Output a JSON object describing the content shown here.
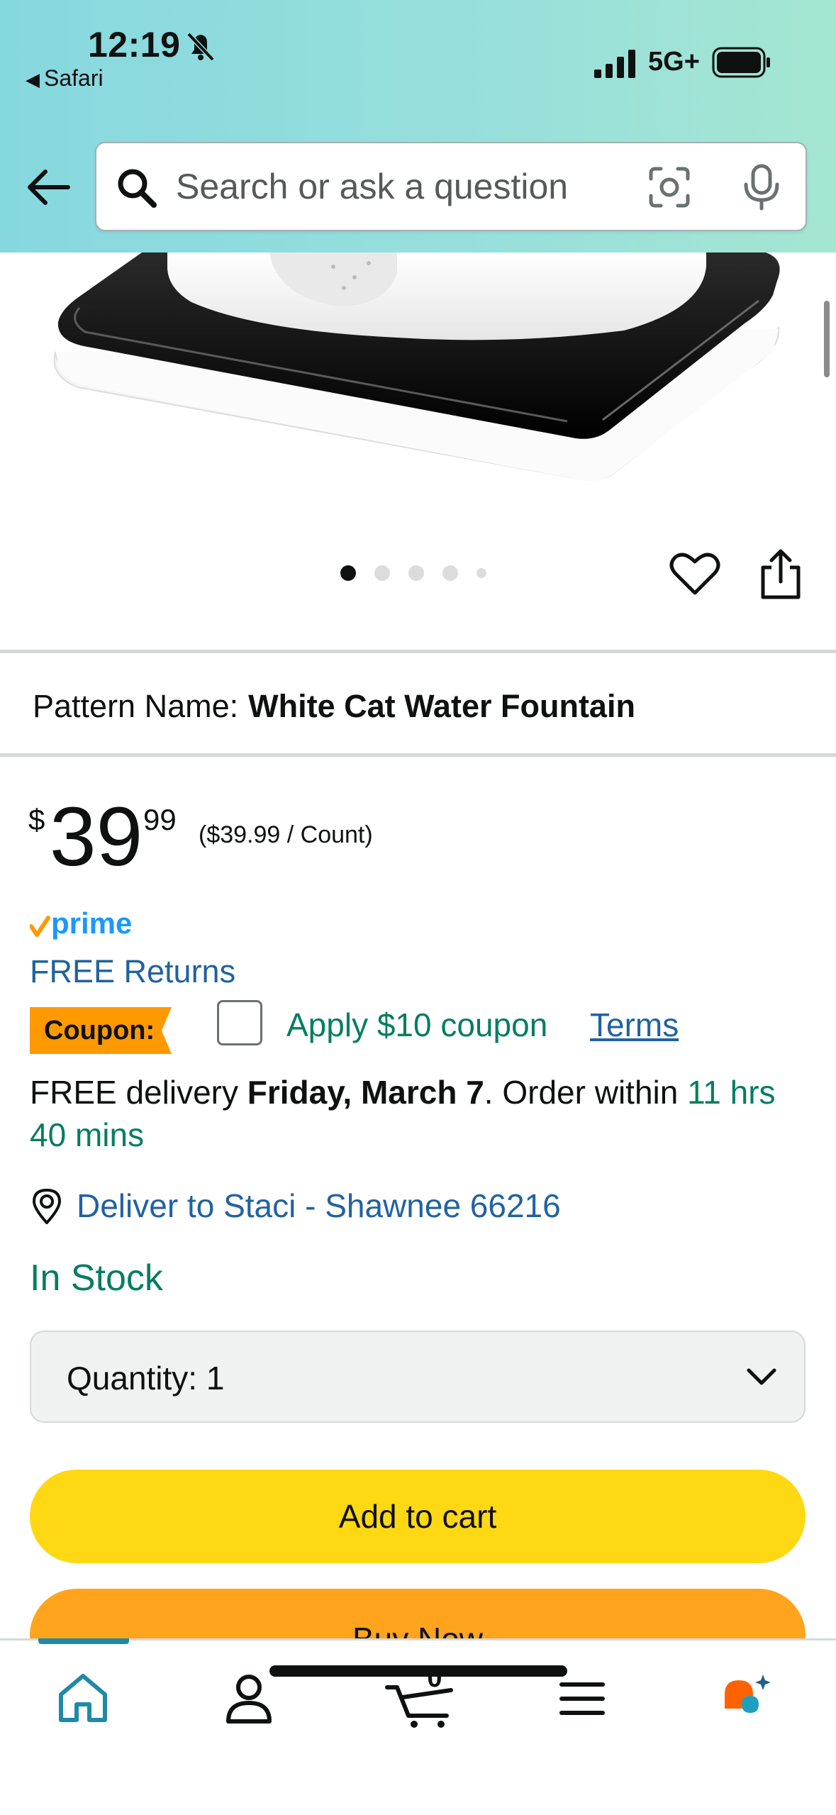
{
  "status_bar": {
    "time": "12:19",
    "back_app": "Safari",
    "network": "5G+",
    "icons": [
      "bell-slash-icon",
      "signal-icon",
      "battery-icon"
    ]
  },
  "search": {
    "placeholder": "Search or ask a question",
    "icons": [
      "back-arrow-icon",
      "search-icon",
      "camera-icon",
      "mic-icon"
    ]
  },
  "carousel": {
    "total": 5,
    "active": 1
  },
  "pattern": {
    "label": "Pattern Name:",
    "value": "White Cat Water Fountain"
  },
  "price": {
    "symbol": "$",
    "whole": "39",
    "fraction": "99",
    "unit_price": "($39.99 / Count)"
  },
  "prime": {
    "label": "prime"
  },
  "returns": {
    "label": "FREE Returns"
  },
  "coupon": {
    "badge": "Coupon:",
    "text": "Apply $10 coupon",
    "terms": "Terms",
    "checked": false
  },
  "delivery": {
    "prefix": "FREE delivery ",
    "date": "Friday, March 7",
    "middle": ". Order within ",
    "countdown": "11 hrs 40 mins"
  },
  "deliver_to": {
    "label": "Deliver to Staci - Shawnee 66216"
  },
  "stock": {
    "status": "In Stock"
  },
  "quantity": {
    "label": "Quantity:",
    "value": "1"
  },
  "buttons": {
    "add_to_cart": "Add to cart",
    "buy_now": "Buy Now"
  },
  "bottom_nav": {
    "items": [
      "home",
      "account",
      "cart",
      "menu",
      "rufus"
    ],
    "cart_count": "0"
  },
  "colors": {
    "header_gradient_start": "#86d8df",
    "header_gradient_end": "#a5e6d2",
    "link": "#2162a1",
    "green": "#067d62",
    "add_to_cart": "#ffd814",
    "buy_now": "#ffa41c",
    "coupon_badge": "#ff9900"
  }
}
